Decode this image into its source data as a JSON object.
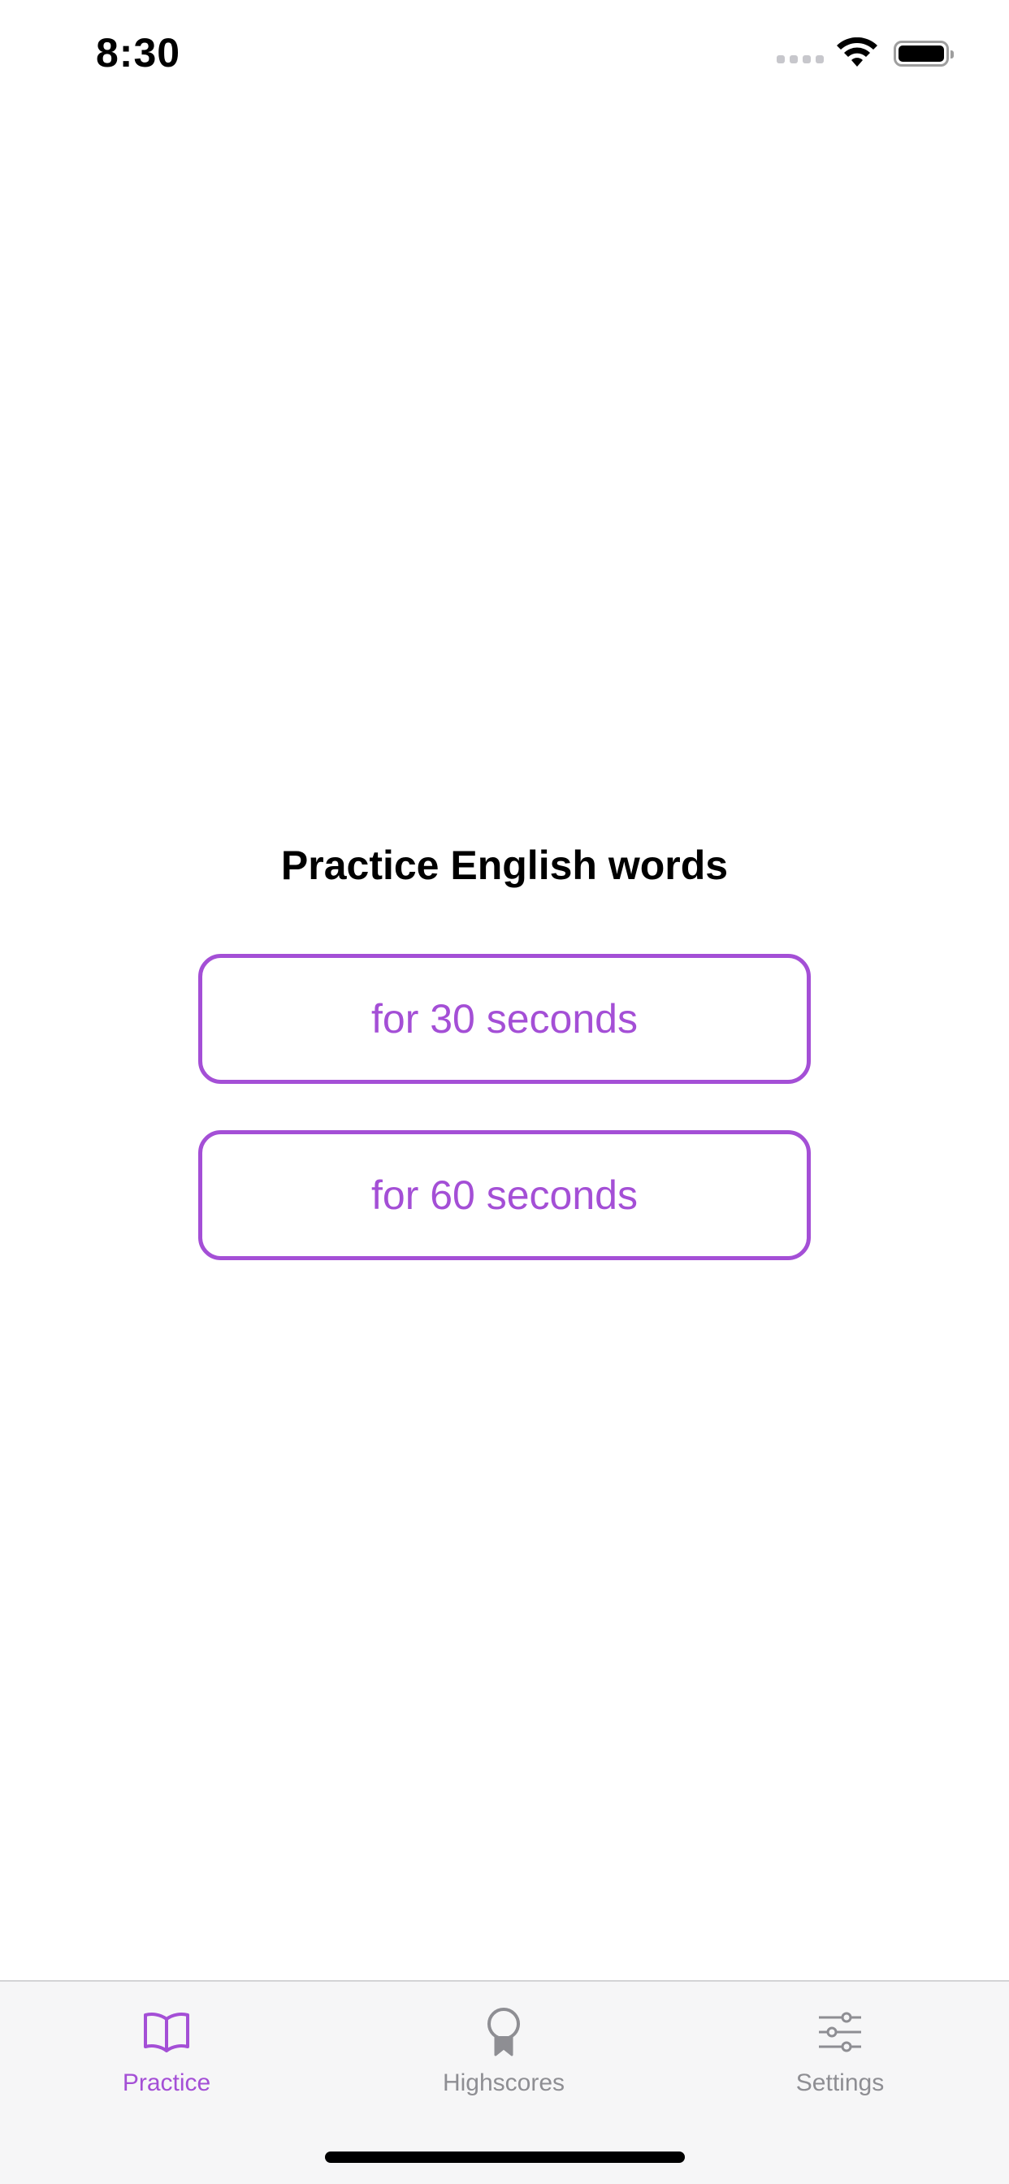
{
  "status_bar": {
    "time": "8:30"
  },
  "main": {
    "title": "Practice English words",
    "buttons": [
      {
        "label": "for 30 seconds"
      },
      {
        "label": "for 60 seconds"
      }
    ]
  },
  "tab_bar": {
    "tabs": [
      {
        "label": "Practice",
        "icon": "book-icon",
        "selected": true
      },
      {
        "label": "Highscores",
        "icon": "award-icon",
        "selected": false
      },
      {
        "label": "Settings",
        "icon": "sliders-icon",
        "selected": false
      }
    ]
  },
  "colors": {
    "accent": "#a44fd6",
    "inactive": "#8e8e93",
    "tab_bar_bg": "#f6f6f7"
  }
}
